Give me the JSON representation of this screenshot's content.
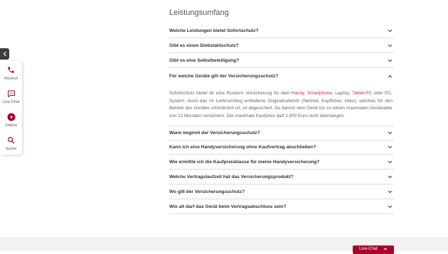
{
  "colors": {
    "accent": "#a8002a",
    "link": "#c7265c",
    "divider": "#dcdcdc"
  },
  "sidebar": {
    "items": [
      {
        "label": "Rückruf",
        "icon": "phone-icon"
      },
      {
        "label": "Live-Chat",
        "icon": "chat-icon"
      },
      {
        "label": "Videos",
        "icon": "play-icon"
      },
      {
        "label": "Suche",
        "icon": "search-icon"
      }
    ]
  },
  "section": {
    "title": "Leistungsumfang"
  },
  "faq": {
    "items": [
      {
        "question": "Welche Leistungen bietet Sofortschutz?",
        "expanded": false
      },
      {
        "question": "Gibt es einen Diebstahlschutz?",
        "expanded": false
      },
      {
        "question": "Gibt es eine Selbstbeteiligung?",
        "expanded": false
      },
      {
        "question": "Für welche Geräte gilt der Versicherungsschutz?",
        "expanded": true
      },
      {
        "question": "Wann beginnt der Versicherungsschutz?",
        "expanded": false
      },
      {
        "question": "Kann ich eine Handyversicherung ohne Kaufvertrag abschließen?",
        "expanded": false
      },
      {
        "question": "Wie ermittle ich die Kaufpreisklasse für meine Handyversicherung?",
        "expanded": false
      },
      {
        "question": "Welche Vertragslaufzeit hat das Versicherungsprodukt?",
        "expanded": false
      },
      {
        "question": "Wo gilt der Versicherungsschutz?",
        "expanded": false
      },
      {
        "question": "Wie alt darf das Gerät beim Vertragsabschluss sein?",
        "expanded": false
      }
    ],
    "answer": {
      "part1": "Sofortschutz bietet dir eine Rundum Versicherung für dein ",
      "link1": "Handy",
      "sep1": ", ",
      "link2": "Smartphone",
      "part2": ", Laptop, ",
      "link3": "Tablet-PC",
      "part3": " oder PC-System. Auch das im Lieferumfang enthaltene Originalzubehör (Netzteil, Kopfhörer, Akku), welches für den Betrieb des Gerätes erforderlich ist, ist abgesichert. Du kannst dein Gerät bis zu einem maximalen Gerätealter von 12 Monaten versichern. Der maximale Kaufpreis darf 2.000 Euro nicht übersteigen."
    }
  },
  "livechat_button": {
    "label": "Live-Chat"
  }
}
